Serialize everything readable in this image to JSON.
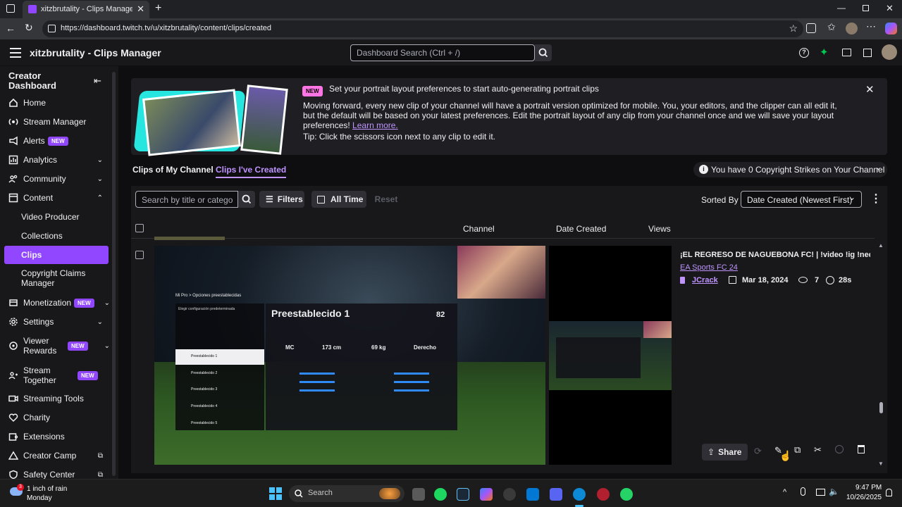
{
  "browser": {
    "tab_title": "xitzbrutality - Clips Manager - Tw",
    "url": "https://dashboard.twitch.tv/u/xitzbrutality/content/clips/created"
  },
  "header": {
    "title": "xitzbrutality - Clips Manager",
    "search_placeholder": "Dashboard Search (Ctrl + /)"
  },
  "sidebar": {
    "heading": "Creator Dashboard",
    "items": [
      {
        "label": "Home"
      },
      {
        "label": "Stream Manager"
      },
      {
        "label": "Alerts",
        "badge": "NEW"
      },
      {
        "label": "Analytics"
      },
      {
        "label": "Community"
      },
      {
        "label": "Content"
      },
      {
        "label": "Video Producer"
      },
      {
        "label": "Collections"
      },
      {
        "label": "Clips"
      },
      {
        "label": "Copyright Claims Manager"
      },
      {
        "label": "Monetization",
        "badge": "NEW"
      },
      {
        "label": "Settings"
      },
      {
        "label": "Viewer Rewards",
        "badge": "NEW"
      },
      {
        "label": "Stream Together",
        "badge": "NEW"
      },
      {
        "label": "Streaming Tools"
      },
      {
        "label": "Charity"
      },
      {
        "label": "Extensions"
      },
      {
        "label": "Creator Camp"
      },
      {
        "label": "Safety Center"
      }
    ]
  },
  "banner": {
    "badge": "NEW",
    "headline": "Set your portrait layout preferences to start auto-generating portrait clips",
    "body": "Moving forward, every new clip of your channel will have a portrait version optimized for mobile. You, your editors, and the clipper can all edit it, but the default will be based on your latest preferences. Edit the portrait layout of any clip from your channel once and we will save your layout preferences!",
    "link": "Learn more.",
    "tip": "Tip: Click the scissors icon next to any clip to edit it."
  },
  "tabs": {
    "tab1": "Clips of My Channel",
    "tab2": "Clips I've Created",
    "strikes": "You have 0 Copyright Strikes on Your Channel"
  },
  "toolbar": {
    "search_placeholder": "Search by title or category",
    "filters": "Filters",
    "all_time": "All Time",
    "reset": "Reset",
    "sorted_by": "Sorted By",
    "sort_value": "Date Created (Newest First)"
  },
  "columns": {
    "channel": "Channel",
    "date": "Date Created",
    "views": "Views"
  },
  "clip": {
    "title": "¡EL REGRESO DE NAGUEBONA FC! | !video !ig !neqon",
    "category": "EA Sports FC 24",
    "channel": "JCrack",
    "date": "Mar 18, 2024",
    "views": "7",
    "duration": "28s",
    "share": "Share",
    "thumb_breadcrumb": "Mi Pro  >  Opciones preestablecidas",
    "thumb_card_title": "Preestablecido 1",
    "thumb_pos": "MC",
    "thumb_height": "173 cm",
    "thumb_weight": "69 kg",
    "thumb_foot": "Derecho",
    "thumb_ovr": "82",
    "thumb_rows": [
      "Preestablecido 1",
      "Preestablecido 2",
      "Preestablecido 3",
      "Preestablecido 4",
      "Preestablecido 5"
    ]
  },
  "taskbar": {
    "weather_line1": "1 inch of rain",
    "weather_line2": "Monday",
    "search": "Search",
    "time": "9:47 PM",
    "date": "10/26/2025"
  },
  "colors": {
    "accent": "#9147ff",
    "link": "#bf94ff",
    "bg": "#0e0e10",
    "panel": "#18181b"
  }
}
